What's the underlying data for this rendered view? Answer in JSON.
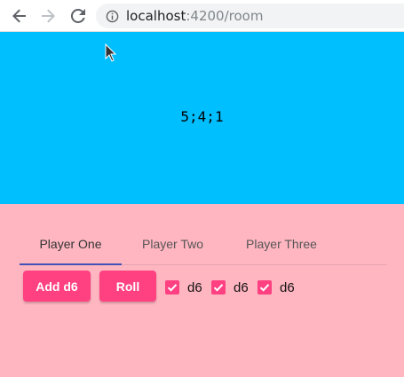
{
  "browser": {
    "url_host": "localhost",
    "url_path": ":4200/room"
  },
  "result": {
    "text": "5;4;1"
  },
  "tabs": [
    {
      "label": "Player One",
      "active": true
    },
    {
      "label": "Player Two",
      "active": false
    },
    {
      "label": "Player Three",
      "active": false
    }
  ],
  "controls": {
    "add_label": "Add d6",
    "roll_label": "Roll"
  },
  "dice": [
    {
      "label": "d6",
      "checked": true
    },
    {
      "label": "d6",
      "checked": true
    },
    {
      "label": "d6",
      "checked": true
    }
  ],
  "colors": {
    "result_bg": "#00bfff",
    "page_bg": "#ffb6c1",
    "accent": "#ff4081",
    "ink_bar": "#3f51b5"
  }
}
